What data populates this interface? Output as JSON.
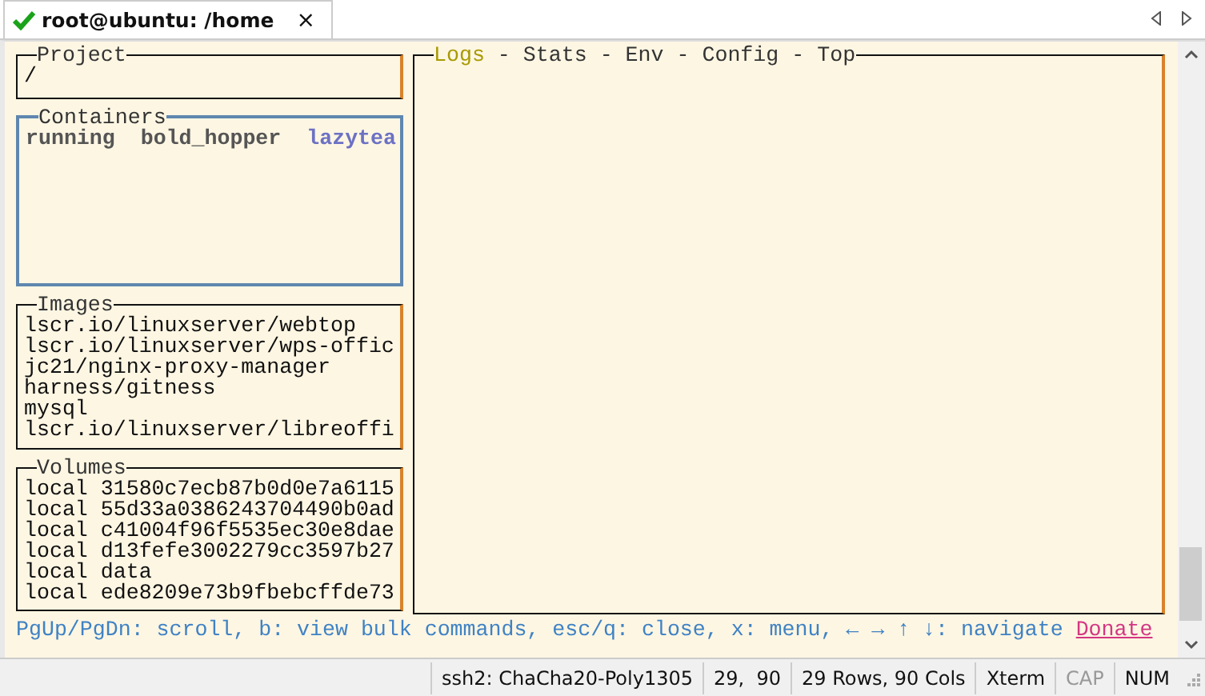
{
  "tab": {
    "title": "root@ubuntu: /home",
    "close": "×"
  },
  "project": {
    "title": "Project",
    "selected": false,
    "lines": [
      "/"
    ]
  },
  "containers": {
    "title": "Containers",
    "selected": true,
    "rows": [
      {
        "status": "running",
        "name": "bold_hopper",
        "project": "lazytea"
      }
    ]
  },
  "images": {
    "title": "Images",
    "selected": false,
    "lines": [
      "lscr.io/linuxserver/webtop",
      "lscr.io/linuxserver/wps-offic",
      "jc21/nginx-proxy-manager",
      "harness/gitness",
      "mysql",
      "lscr.io/linuxserver/libreoffi"
    ]
  },
  "volumes": {
    "title": "Volumes",
    "selected": false,
    "lines": [
      "local 31580c7ecb87b0d0e7a6115",
      "local 55d33a0386243704490b0ad",
      "local c41004f96f5535ec30e8dae",
      "local d13fefe3002279cc3597b27",
      "local data",
      "local ede8209e73b9fbebcffde73"
    ]
  },
  "main_tabs": [
    {
      "label": "Logs",
      "selected": true
    },
    {
      "label": "Stats",
      "selected": false
    },
    {
      "label": "Env",
      "selected": false
    },
    {
      "label": "Config",
      "selected": false
    },
    {
      "label": "Top",
      "selected": false
    }
  ],
  "separator": "-",
  "help": "PgUp/PgDn: scroll, b: view bulk commands, esc/q: close, x: menu, ← → ↑ ↓: navigate",
  "donate": "Donate",
  "status_bar": [
    {
      "text": "ssh2: ChaCha20-Poly1305",
      "on": true
    },
    {
      "text": "29,  90",
      "on": true
    },
    {
      "text": "29 Rows, 90 Cols",
      "on": true
    },
    {
      "text": "Xterm",
      "on": true
    },
    {
      "text": "CAP",
      "on": false
    },
    {
      "text": "NUM",
      "on": true
    }
  ]
}
